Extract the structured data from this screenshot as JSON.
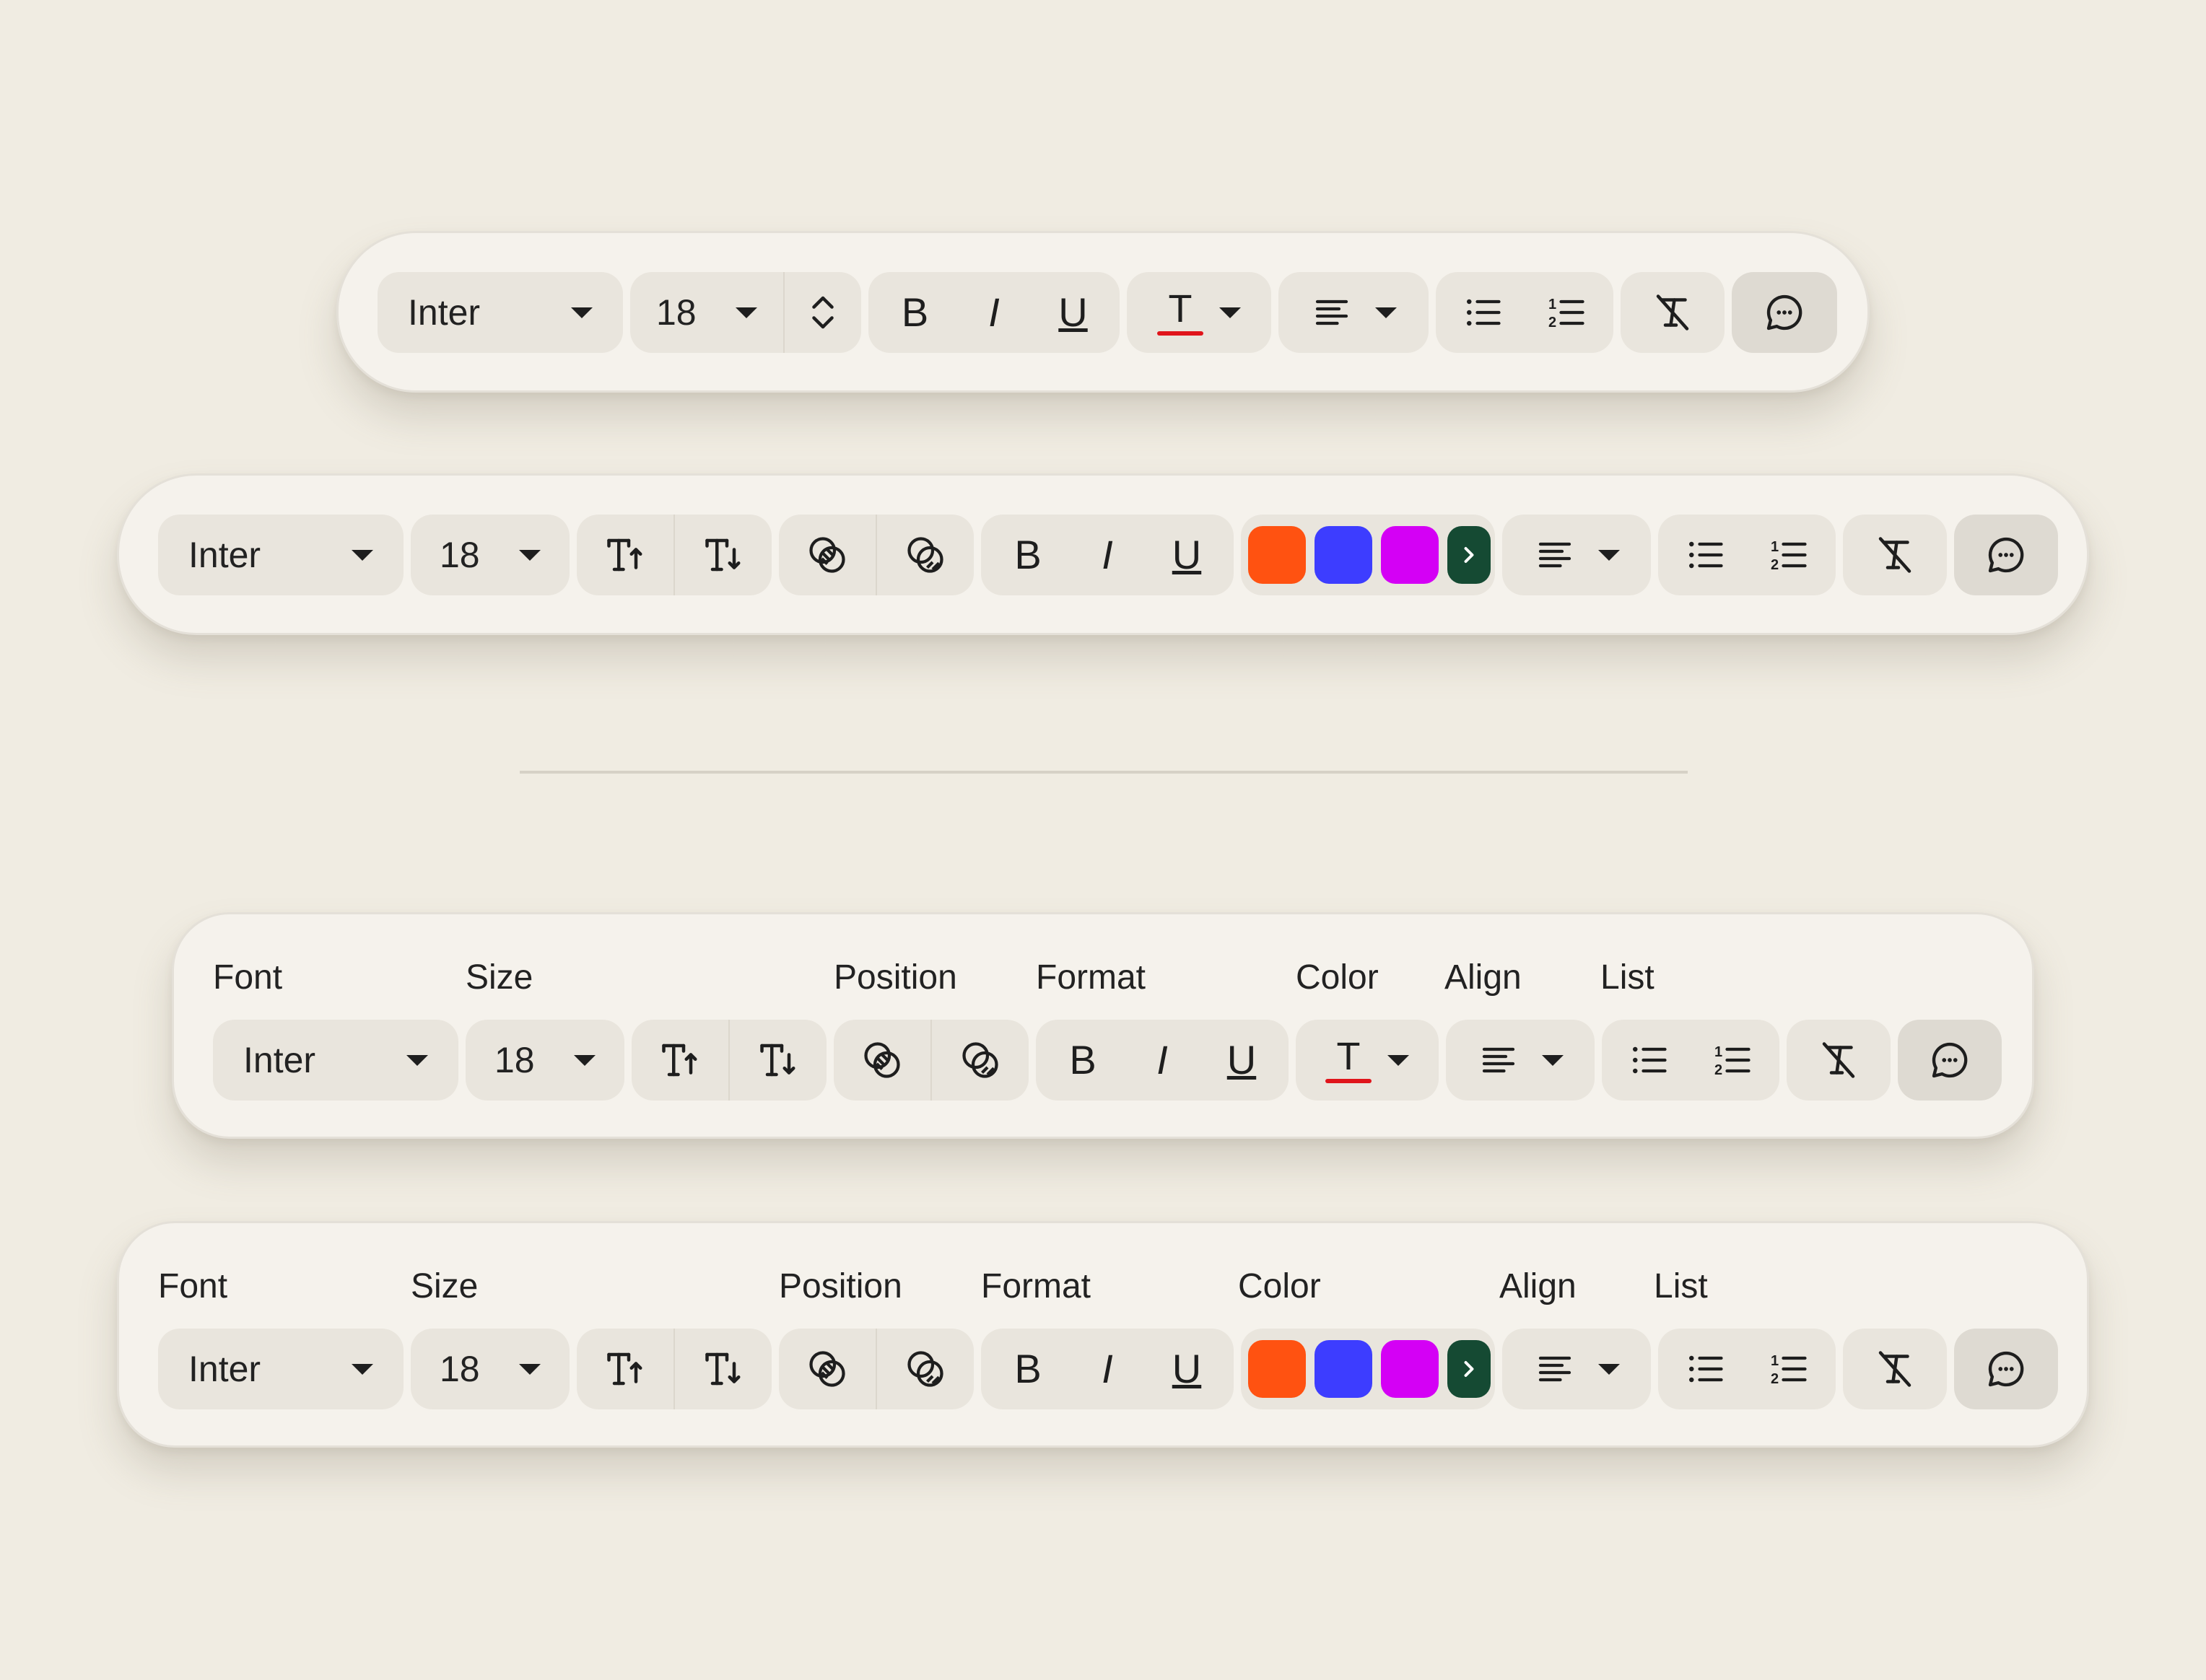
{
  "colors": {
    "background": "#f0ece2",
    "toolbar": "#f5f2ec",
    "group": "#e9e5dd",
    "swatch_orange": "#ff5211",
    "swatch_blue": "#3d3dff",
    "swatch_magenta": "#d400f5",
    "more_button": "#154a33",
    "text_color_underline": "#e0151b"
  },
  "toolbar1": {
    "font_value": "Inter",
    "size_value": "18",
    "bold_label": "B",
    "italic_label": "I",
    "underline_label": "U",
    "text_color_label": "T"
  },
  "toolbar2": {
    "font_value": "Inter",
    "size_value": "18",
    "bold_label": "B",
    "italic_label": "I",
    "underline_label": "U"
  },
  "toolbar3": {
    "labels": {
      "font": "Font",
      "size": "Size",
      "position": "Position",
      "format": "Format",
      "color": "Color",
      "align": "Align",
      "list": "List"
    },
    "font_value": "Inter",
    "size_value": "18",
    "bold_label": "B",
    "italic_label": "I",
    "underline_label": "U",
    "text_color_label": "T"
  },
  "toolbar4": {
    "labels": {
      "font": "Font",
      "size": "Size",
      "position": "Position",
      "format": "Format",
      "color": "Color",
      "align": "Align",
      "list": "List"
    },
    "font_value": "Inter",
    "size_value": "18",
    "bold_label": "B",
    "italic_label": "I",
    "underline_label": "U"
  },
  "icons": [
    "chevron-updown-icon",
    "increase-size-icon",
    "decrease-size-icon",
    "bring-forward-icon",
    "send-backward-icon",
    "align-left-icon",
    "bullet-list-icon",
    "numbered-list-icon",
    "clear-format-icon",
    "comment-icon",
    "chevron-right-icon",
    "caret-down-icon"
  ]
}
